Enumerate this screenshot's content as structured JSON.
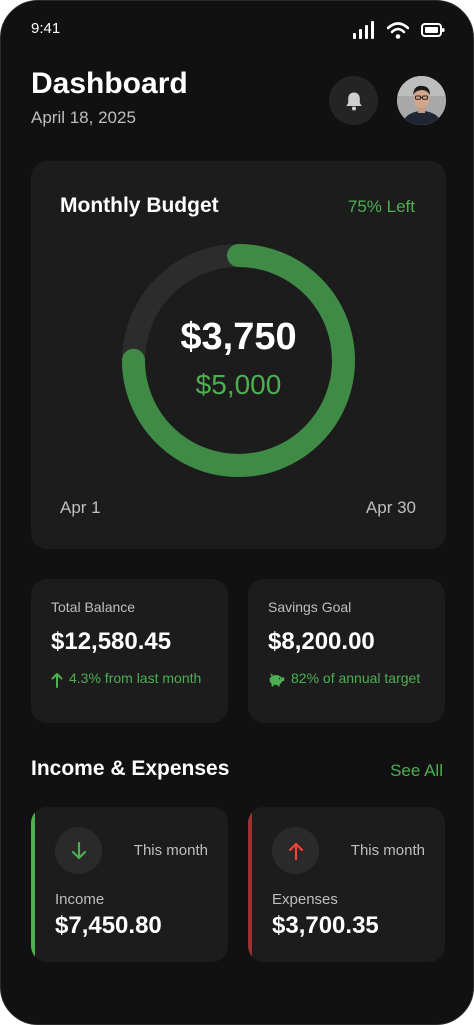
{
  "status_bar": {
    "time": "9:41"
  },
  "header": {
    "title": "Dashboard",
    "date": "April 18, 2025"
  },
  "budget": {
    "title": "Monthly Budget",
    "left_label": "75% Left",
    "spent": "$3,750",
    "total": "$5,000",
    "remaining_fraction": 0.75,
    "start_date": "Apr 1",
    "end_date": "Apr 30"
  },
  "stats": [
    {
      "label": "Total Balance",
      "value": "$12,580.45",
      "note": "4.3% from last month",
      "icon": "arrow-up-icon"
    },
    {
      "label": "Savings Goal",
      "value": "$8,200.00",
      "note": "82% of annual target",
      "icon": "piggy-bank-icon"
    }
  ],
  "income_expenses": {
    "title": "Income & Expenses",
    "see_all": "See All",
    "items": [
      {
        "label": "Income",
        "value": "$7,450.80",
        "period": "This month",
        "icon": "arrow-down-icon",
        "color": "#4caf50"
      },
      {
        "label": "Expenses",
        "value": "$3,700.35",
        "period": "This month",
        "icon": "arrow-up-icon",
        "color": "#f44336"
      }
    ]
  },
  "colors": {
    "accent": "#4caf50",
    "danger": "#f44336",
    "background": "#111111",
    "card": "#1c1c1c"
  }
}
